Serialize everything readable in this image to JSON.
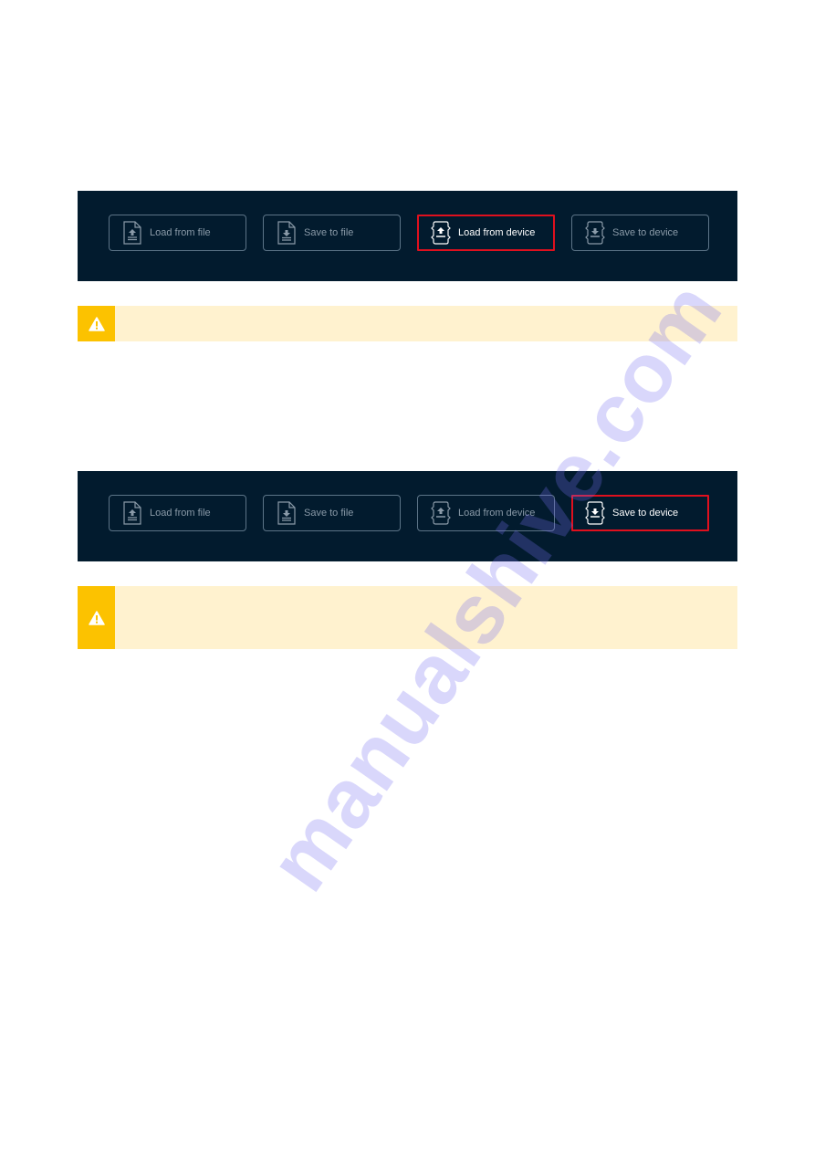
{
  "sections": [
    {
      "toolbar": {
        "buttons": [
          {
            "label": "Load from file",
            "icon": "file-upload-icon",
            "active": false
          },
          {
            "label": "Save to file",
            "icon": "file-download-icon",
            "active": false
          },
          {
            "label": "Load from device",
            "icon": "device-upload-icon",
            "active": true
          },
          {
            "label": "Save to device",
            "icon": "device-download-icon",
            "active": false
          }
        ]
      },
      "warning": {
        "icon": "warning-icon",
        "text": ""
      }
    },
    {
      "toolbar": {
        "buttons": [
          {
            "label": "Load from file",
            "icon": "file-upload-icon",
            "active": false
          },
          {
            "label": "Save to file",
            "icon": "file-download-icon",
            "active": false
          },
          {
            "label": "Load from device",
            "icon": "device-upload-icon",
            "active": false
          },
          {
            "label": "Save to device",
            "icon": "device-download-icon",
            "active": true
          }
        ]
      },
      "warning": {
        "icon": "warning-icon",
        "text": ""
      }
    }
  ],
  "colors": {
    "panel_bg": "#021b2e",
    "highlight": "#e0101e",
    "warning_accent": "#fcc200",
    "warning_bg": "#fff2cf"
  },
  "watermark": "manualshive.com"
}
